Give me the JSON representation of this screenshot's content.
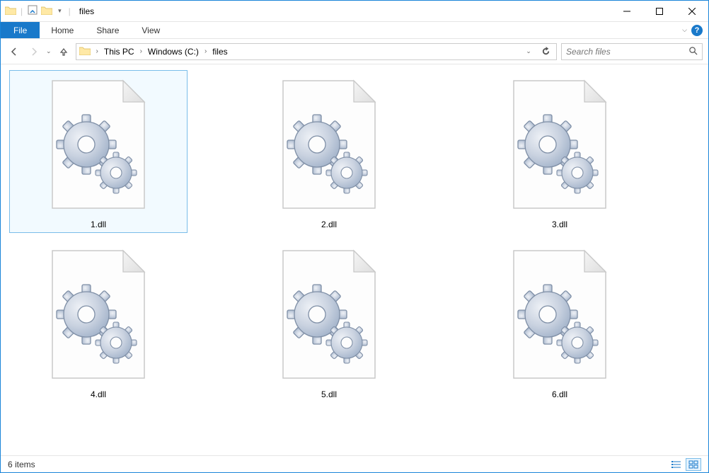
{
  "window": {
    "title": "files"
  },
  "menu": {
    "file": "File",
    "home": "Home",
    "share": "Share",
    "view": "View"
  },
  "breadcrumb": {
    "items": [
      "This PC",
      "Windows (C:)",
      "files"
    ]
  },
  "search": {
    "placeholder": "Search files"
  },
  "files": {
    "items": [
      {
        "name": "1.dll",
        "selected": true
      },
      {
        "name": "2.dll",
        "selected": false
      },
      {
        "name": "3.dll",
        "selected": false
      },
      {
        "name": "4.dll",
        "selected": false
      },
      {
        "name": "5.dll",
        "selected": false
      },
      {
        "name": "6.dll",
        "selected": false
      }
    ]
  },
  "status": {
    "count_label": "6 items"
  }
}
